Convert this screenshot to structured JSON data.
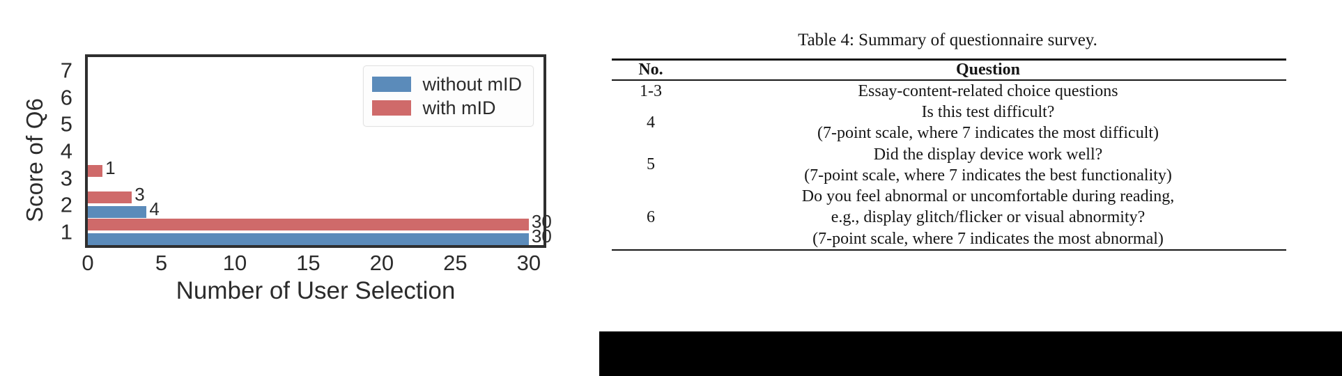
{
  "chart_data": {
    "type": "bar",
    "orientation": "horizontal",
    "title": "",
    "xlabel": "Number of User Selection",
    "ylabel": "Score of Q6",
    "categories": [
      "1",
      "2",
      "3",
      "4",
      "5",
      "6",
      "7"
    ],
    "xlim": [
      0,
      31
    ],
    "ylim": [
      0.5,
      7.5
    ],
    "xticks": [
      0,
      5,
      10,
      15,
      20,
      25,
      30
    ],
    "yticks": [
      1,
      2,
      3,
      4,
      5,
      6,
      7
    ],
    "grid": false,
    "legend_position": "upper right",
    "series": [
      {
        "name": "without mID",
        "color": "#5b8bba",
        "values": [
          30,
          4,
          0,
          0,
          0,
          0,
          0
        ],
        "point_labels": [
          "30",
          "4",
          "",
          "",
          "",
          "",
          ""
        ]
      },
      {
        "name": "with mID",
        "color": "#cf6a6a",
        "values": [
          30,
          3,
          1,
          0,
          0,
          0,
          0
        ],
        "point_labels": [
          "30",
          "3",
          "1",
          "",
          "",
          "",
          ""
        ]
      }
    ],
    "annotations": [
      {
        "text": "1",
        "series": "with mID",
        "category": "3"
      },
      {
        "text": "3",
        "series": "with mID",
        "category": "2"
      },
      {
        "text": "4",
        "series": "without mID",
        "category": "2"
      },
      {
        "text": "30",
        "series": "with mID",
        "category": "1"
      },
      {
        "text": "30",
        "series": "without mID",
        "category": "1"
      }
    ]
  },
  "chart": {
    "ylabel": "Score of Q6",
    "xlabel": "Number of User Selection",
    "yticks": [
      "7",
      "6",
      "5",
      "4",
      "3",
      "2",
      "1"
    ],
    "xticks": [
      "0",
      "5",
      "10",
      "15",
      "20",
      "25",
      "30"
    ],
    "legend": [
      {
        "label": "without mID",
        "color": "#5b8bba"
      },
      {
        "label": "with mID",
        "color": "#cf6a6a"
      }
    ],
    "bars": [
      {
        "label": "1",
        "series": "with mID",
        "score": "3",
        "value": 1
      },
      {
        "label": "3",
        "series": "with mID",
        "score": "2",
        "value": 3
      },
      {
        "label": "4",
        "series": "without mID",
        "score": "2",
        "value": 4
      },
      {
        "label": "30",
        "series": "with mID",
        "score": "1",
        "value": 30
      },
      {
        "label": "30",
        "series": "without mID",
        "score": "1",
        "value": 30
      }
    ]
  },
  "table": {
    "caption": "Table 4: Summary of questionnaire survey.",
    "headers": {
      "no": "No.",
      "question": "Question"
    },
    "rows": [
      {
        "no": "1-3",
        "lines": [
          "Essay-content-related choice questions"
        ]
      },
      {
        "no": "4",
        "lines": [
          "Is this test difficult?",
          "(7-point scale, where 7 indicates the most difficult)"
        ]
      },
      {
        "no": "5",
        "lines": [
          "Did the display device work well?",
          "(7-point scale, where 7 indicates the best functionality)"
        ]
      },
      {
        "no": "6",
        "lines": [
          "Do you feel abnormal or uncomfortable during reading,",
          "e.g., display glitch/flicker or visual abnormity?",
          "(7-point scale, where 7 indicates the most abnormal)"
        ]
      }
    ]
  }
}
